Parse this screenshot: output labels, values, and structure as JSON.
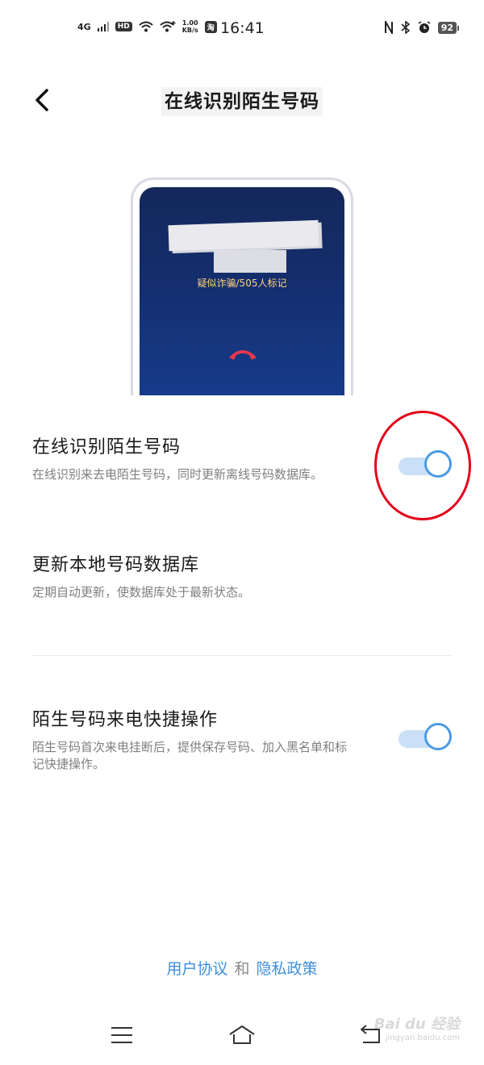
{
  "status_bar": {
    "network": "4G",
    "hd": "HD",
    "speed_value": "1.00",
    "speed_unit": "KB/s",
    "app_badge": "淘",
    "time": "16:41",
    "battery": "92",
    "icons": [
      "signal-icon",
      "wifi-icon",
      "wifi-plus-icon",
      "nfc-icon",
      "bluetooth-icon",
      "alarm-icon"
    ]
  },
  "header": {
    "title": "在线识别陌生号码"
  },
  "illustration": {
    "caller_tag": "疑似诈骗/505人标记"
  },
  "settings": [
    {
      "title": "在线识别陌生号码",
      "desc": "在线识别来去电陌生号码，同时更新离线号码数据库。",
      "toggle_on": true
    },
    {
      "title": "更新本地号码数据库",
      "desc": "定期自动更新，使数据库处于最新状态。"
    },
    {
      "title": "陌生号码来电快捷操作",
      "desc": "陌生号码首次来电挂断后，提供保存号码、加入黑名单和标记快捷操作。",
      "toggle_on": true
    }
  ],
  "footer": {
    "user_agreement": "用户协议",
    "and": "和",
    "privacy_policy": "隐私政策"
  },
  "watermark": {
    "brand": "Bai du 经验",
    "url": "jingyan.baidu.com"
  },
  "colors": {
    "accent": "#4a9be6",
    "toggle_track": "#c9e0f6",
    "link": "#3f8fd8",
    "highlight": "#e3001a"
  }
}
